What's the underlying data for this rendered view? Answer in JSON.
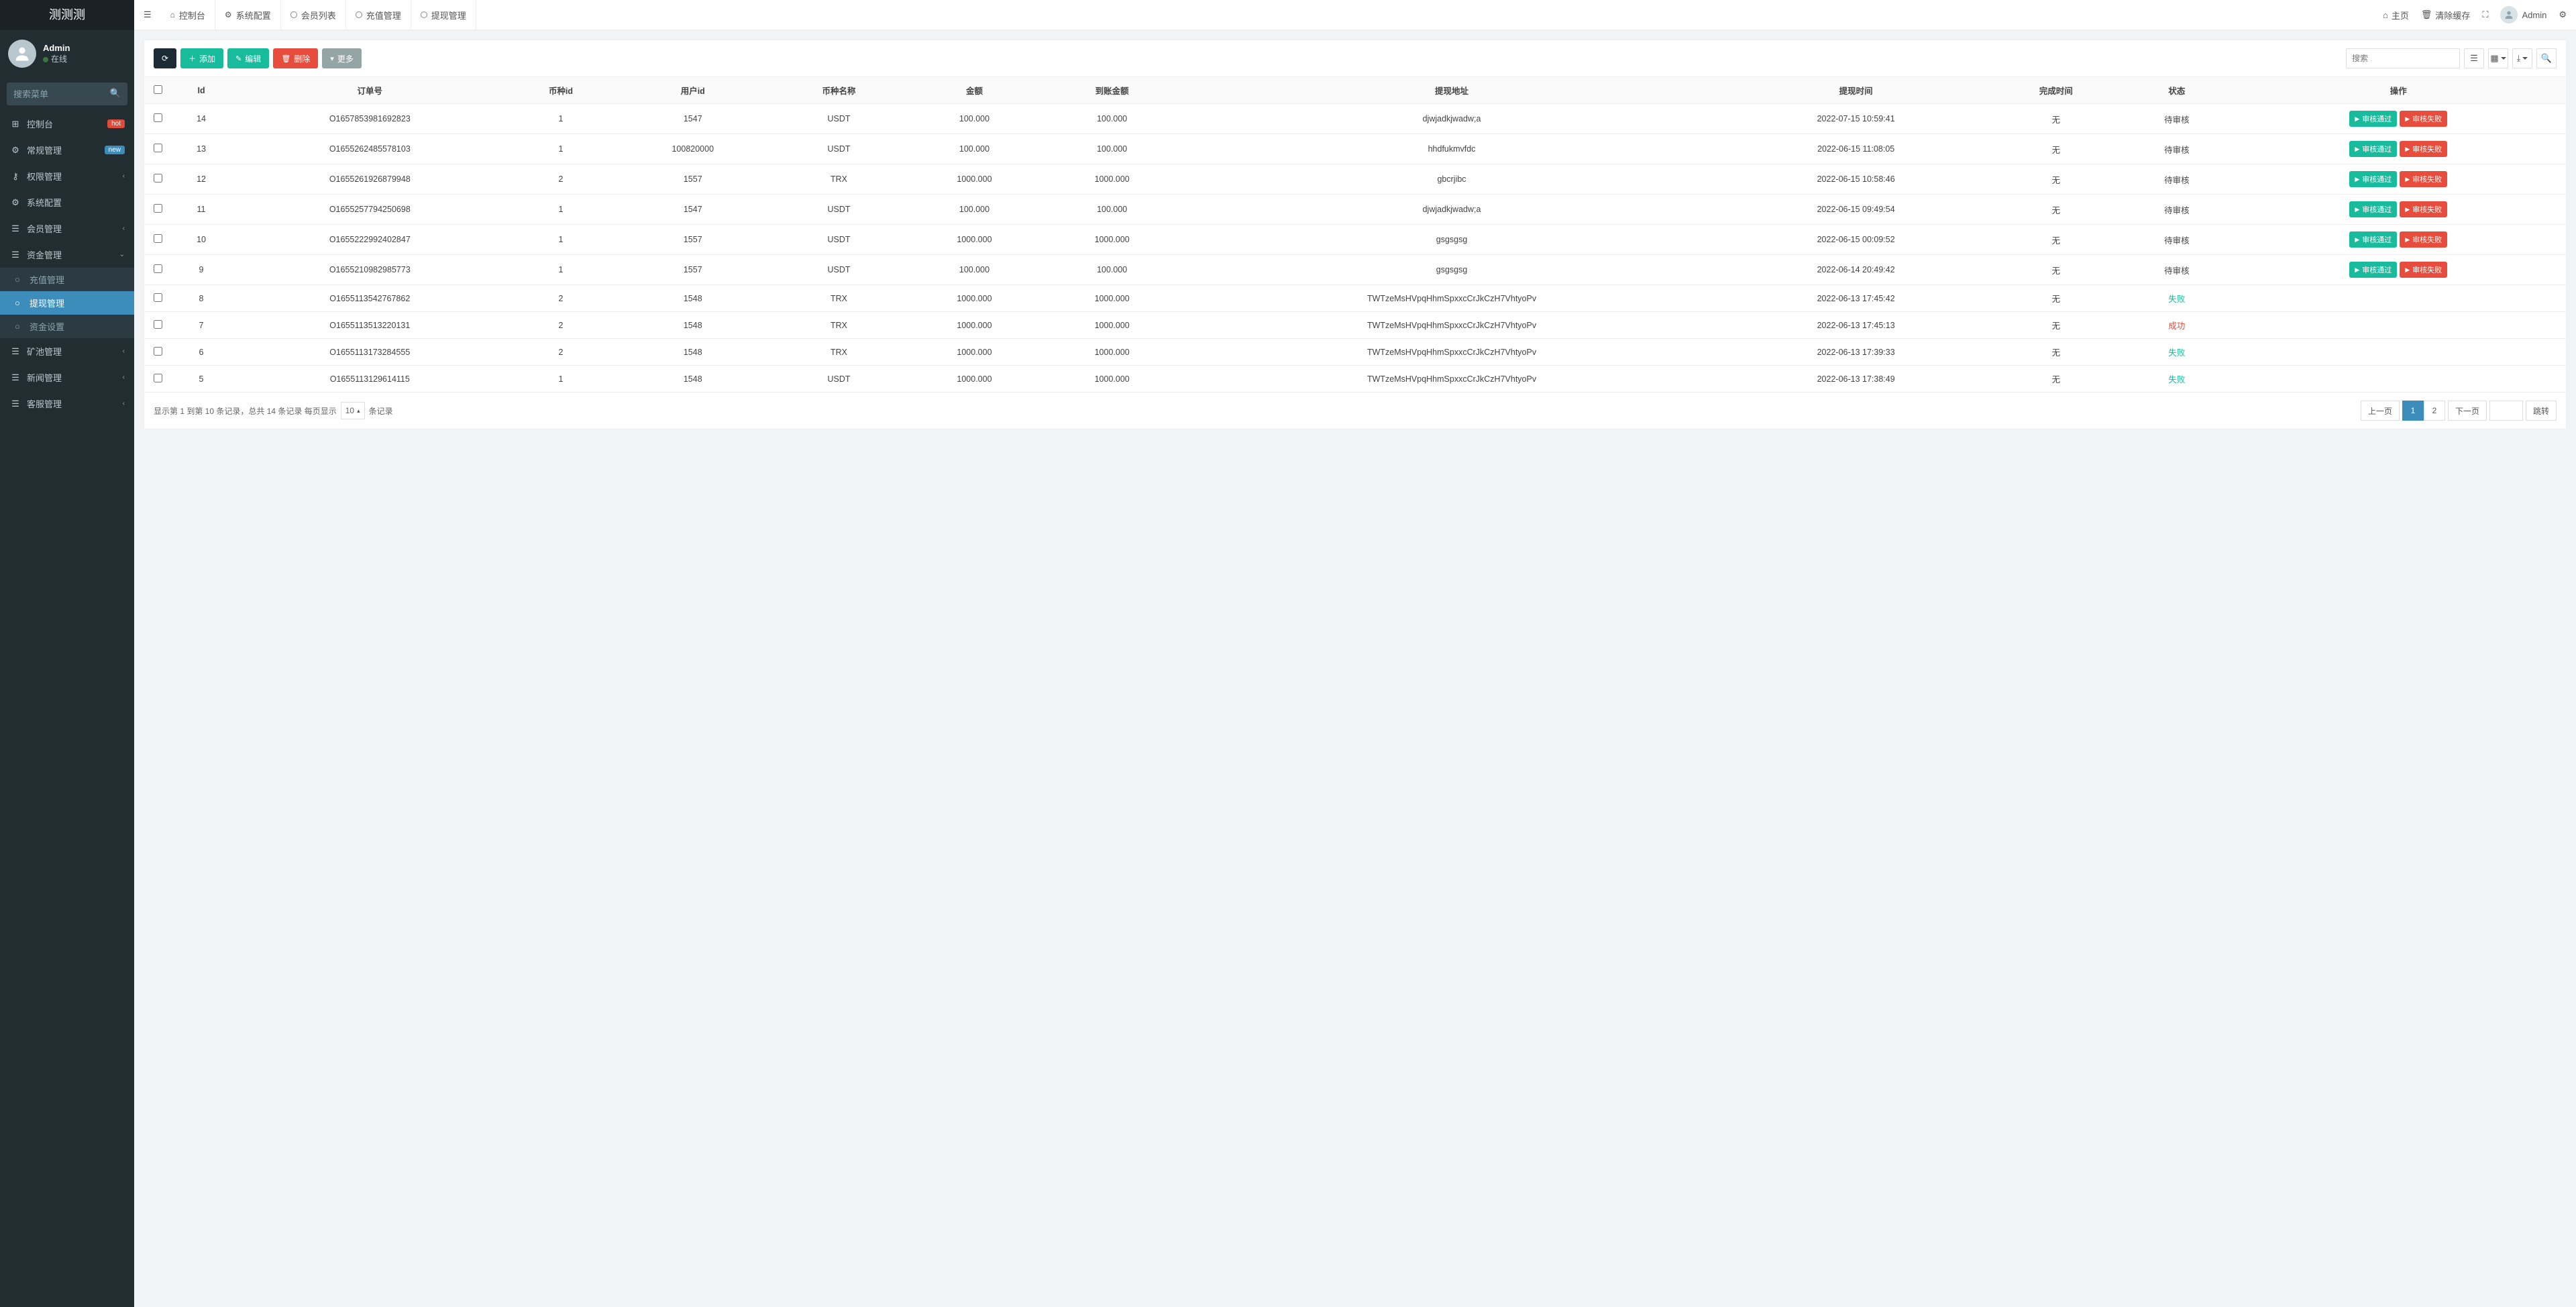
{
  "app": {
    "title": "测测测"
  },
  "user": {
    "name": "Admin",
    "status": "在线"
  },
  "sidebar": {
    "search_placeholder": "搜索菜单",
    "items": [
      {
        "icon": "⊞",
        "label": "控制台",
        "badge": "hot",
        "badgeClass": "badge-hot"
      },
      {
        "icon": "⚙",
        "label": "常规管理",
        "badge": "new",
        "badgeClass": "badge-new"
      },
      {
        "icon": "⚷",
        "label": "权限管理",
        "arrow": true
      },
      {
        "icon": "⚙",
        "label": "系统配置"
      },
      {
        "icon": "☰",
        "label": "会员管理",
        "arrow": true
      },
      {
        "icon": "☰",
        "label": "资金管理",
        "arrow": true,
        "open": true,
        "children": [
          {
            "label": "充值管理"
          },
          {
            "label": "提现管理",
            "selected": true
          },
          {
            "label": "资金设置"
          }
        ]
      },
      {
        "icon": "☰",
        "label": "矿池管理",
        "arrow": true
      },
      {
        "icon": "☰",
        "label": "新闻管理",
        "arrow": true
      },
      {
        "icon": "☰",
        "label": "客服管理",
        "arrow": true
      }
    ]
  },
  "header": {
    "tabs": [
      {
        "icon": "home",
        "label": "控制台"
      },
      {
        "icon": "gear",
        "label": "系统配置"
      },
      {
        "icon": "circle",
        "label": "会员列表"
      },
      {
        "icon": "circle",
        "label": "充值管理"
      },
      {
        "icon": "circle",
        "label": "提现管理",
        "current": true
      }
    ],
    "right": {
      "home": "主页",
      "clear_cache": "清除缓存",
      "fullscreen": "⛶",
      "user": "Admin",
      "settings": "⚙"
    }
  },
  "toolbar": {
    "refresh": "",
    "add": "添加",
    "edit": "编辑",
    "delete": "删除",
    "more": "更多",
    "search_placeholder": "搜索"
  },
  "table": {
    "headers": [
      "",
      "Id",
      "订单号",
      "币种id",
      "用户id",
      "币种名称",
      "金额",
      "到账金额",
      "提现地址",
      "提现时间",
      "完成时间",
      "状态",
      "操作"
    ],
    "row_buttons": {
      "pass": "审核通过",
      "fail": "审核失败"
    },
    "rows": [
      {
        "id": "14",
        "order": "O1657853981692823",
        "coin_id": "1",
        "user_id": "1547",
        "coin": "USDT",
        "amount": "100.000",
        "received": "100.000",
        "addr": "djwjadkjwadw;a",
        "time": "2022-07-15 10:59:41",
        "done": "无",
        "status": "待审核",
        "status_type": "pending",
        "buttons": true
      },
      {
        "id": "13",
        "order": "O1655262485578103",
        "coin_id": "1",
        "user_id": "100820000",
        "coin": "USDT",
        "amount": "100.000",
        "received": "100.000",
        "addr": "hhdfukmvfdc",
        "time": "2022-06-15 11:08:05",
        "done": "无",
        "status": "待审核",
        "status_type": "pending",
        "buttons": true
      },
      {
        "id": "12",
        "order": "O1655261926879948",
        "coin_id": "2",
        "user_id": "1557",
        "coin": "TRX",
        "amount": "1000.000",
        "received": "1000.000",
        "addr": "gbcrjibc",
        "time": "2022-06-15 10:58:46",
        "done": "无",
        "status": "待审核",
        "status_type": "pending",
        "buttons": true
      },
      {
        "id": "11",
        "order": "O1655257794250698",
        "coin_id": "1",
        "user_id": "1547",
        "coin": "USDT",
        "amount": "100.000",
        "received": "100.000",
        "addr": "djwjadkjwadw;a",
        "time": "2022-06-15 09:49:54",
        "done": "无",
        "status": "待审核",
        "status_type": "pending",
        "buttons": true
      },
      {
        "id": "10",
        "order": "O1655222992402847",
        "coin_id": "1",
        "user_id": "1557",
        "coin": "USDT",
        "amount": "1000.000",
        "received": "1000.000",
        "addr": "gsgsgsg",
        "time": "2022-06-15 00:09:52",
        "done": "无",
        "status": "待审核",
        "status_type": "pending",
        "buttons": true
      },
      {
        "id": "9",
        "order": "O1655210982985773",
        "coin_id": "1",
        "user_id": "1557",
        "coin": "USDT",
        "amount": "100.000",
        "received": "100.000",
        "addr": "gsgsgsg",
        "time": "2022-06-14 20:49:42",
        "done": "无",
        "status": "待审核",
        "status_type": "pending",
        "buttons": true
      },
      {
        "id": "8",
        "order": "O1655113542767862",
        "coin_id": "2",
        "user_id": "1548",
        "coin": "TRX",
        "amount": "1000.000",
        "received": "1000.000",
        "addr": "TWTzeMsHVpqHhmSpxxcCrJkCzH7VhtyoPv",
        "time": "2022-06-13 17:45:42",
        "done": "无",
        "status": "失败",
        "status_type": "fail",
        "buttons": false
      },
      {
        "id": "7",
        "order": "O1655113513220131",
        "coin_id": "2",
        "user_id": "1548",
        "coin": "TRX",
        "amount": "1000.000",
        "received": "1000.000",
        "addr": "TWTzeMsHVpqHhmSpxxcCrJkCzH7VhtyoPv",
        "time": "2022-06-13 17:45:13",
        "done": "无",
        "status": "成功",
        "status_type": "success",
        "buttons": false
      },
      {
        "id": "6",
        "order": "O1655113173284555",
        "coin_id": "2",
        "user_id": "1548",
        "coin": "TRX",
        "amount": "1000.000",
        "received": "1000.000",
        "addr": "TWTzeMsHVpqHhmSpxxcCrJkCzH7VhtyoPv",
        "time": "2022-06-13 17:39:33",
        "done": "无",
        "status": "失败",
        "status_type": "fail",
        "buttons": false
      },
      {
        "id": "5",
        "order": "O1655113129614115",
        "coin_id": "1",
        "user_id": "1548",
        "coin": "USDT",
        "amount": "1000.000",
        "received": "1000.000",
        "addr": "TWTzeMsHVpqHhmSpxxcCrJkCzH7VhtyoPv",
        "time": "2022-06-13 17:38:49",
        "done": "无",
        "status": "失败",
        "status_type": "fail",
        "buttons": false
      }
    ]
  },
  "footer": {
    "info_prefix": "显示第 1 到第 10 条记录，总共 14 条记录 每页显示",
    "per_page": "10",
    "info_suffix": "条记录",
    "prev": "上一页",
    "next": "下一页",
    "jump": "跳转",
    "pages": [
      "1",
      "2"
    ],
    "current_page": "1"
  }
}
